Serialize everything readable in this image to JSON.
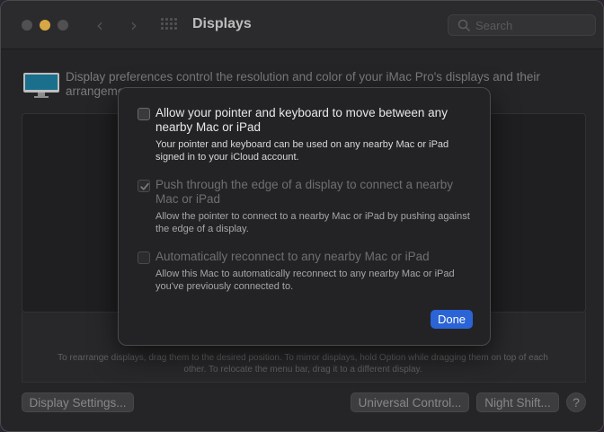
{
  "window": {
    "title": "Displays",
    "search_placeholder": "Search"
  },
  "main": {
    "description": "Display preferences control the resolution and color of your iMac Pro's displays and their arrangement.",
    "arrange_help": "To rearrange displays, drag them to the desired position. To mirror displays, hold Option while dragging them on top of each other. To relocate the menu bar, drag it to a different display.",
    "buttons": {
      "display_settings": "Display Settings...",
      "universal_control": "Universal Control...",
      "night_shift": "Night Shift...",
      "help": "?"
    }
  },
  "sheet": {
    "options": [
      {
        "label": "Allow your pointer and keyboard to move between any nearby Mac or iPad",
        "description": "Your pointer and keyboard can be used on any nearby Mac or iPad signed in to your iCloud account.",
        "checked": false,
        "enabled": true
      },
      {
        "label": "Push through the edge of a display to connect a nearby Mac or iPad",
        "description": "Allow the pointer to connect to a nearby Mac or iPad by pushing against the edge of a display.",
        "checked": true,
        "enabled": false
      },
      {
        "label": "Automatically reconnect to any nearby Mac or iPad",
        "description": "Allow this Mac to automatically reconnect to any nearby Mac or iPad you've previously connected to.",
        "checked": false,
        "enabled": false
      }
    ],
    "done_label": "Done"
  },
  "colors": {
    "accent": "#2a64d6",
    "minimize": "#f6bf4f"
  }
}
